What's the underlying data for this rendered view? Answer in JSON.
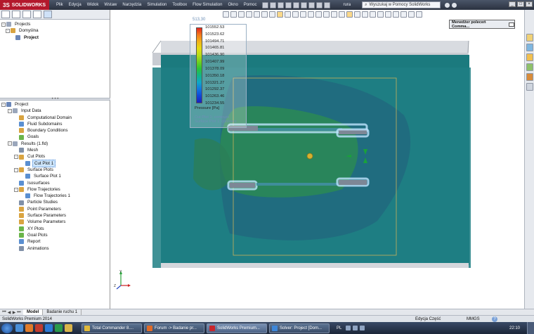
{
  "app": {
    "logo_ds": "3S",
    "logo_text": "SOLIDWORKS",
    "menu": [
      "Plik",
      "Edycja",
      "Widok",
      "Wstaw",
      "Narzędzia",
      "Simulation",
      "Toolbox",
      "Flow Simulation",
      "Okno",
      "Pomoc"
    ],
    "file_name": "rura",
    "search_placeholder": "Wyszukaj w Pomocy SolidWorks",
    "window_controls": [
      "_",
      "□",
      "×"
    ]
  },
  "left_top": {
    "root_label": "Projects",
    "config_label": "Domyślna",
    "project_label": "Project"
  },
  "tree": {
    "items": [
      {
        "label": "Project",
        "level": 0,
        "expand": "-",
        "icon_color": "#6a86b8"
      },
      {
        "label": "Input Data",
        "level": 1,
        "expand": "-",
        "icon_color": "#9aa6bb"
      },
      {
        "label": "Computational Domain",
        "level": 2,
        "expand": "",
        "icon_color": "#d9a441"
      },
      {
        "label": "Fluid Subdomains",
        "level": 2,
        "expand": "",
        "icon_color": "#5a8fd1"
      },
      {
        "label": "Boundary Conditions",
        "level": 2,
        "expand": "",
        "icon_color": "#d9a441"
      },
      {
        "label": "Goals",
        "level": 2,
        "expand": "",
        "icon_color": "#6bb54a"
      },
      {
        "label": "Results (1.fld)",
        "level": 1,
        "expand": "-",
        "icon_color": "#9aa6bb"
      },
      {
        "label": "Mesh",
        "level": 2,
        "expand": "",
        "icon_color": "#8090a8"
      },
      {
        "label": "Cut Plots",
        "level": 2,
        "expand": "-",
        "icon_color": "#d9a441"
      },
      {
        "label": "Cut Plot 1",
        "level": 3,
        "expand": "",
        "icon_color": "#5a8fd1",
        "selected": true
      },
      {
        "label": "Surface Plots",
        "level": 2,
        "expand": "-",
        "icon_color": "#d9a441"
      },
      {
        "label": "Surface Plot 1",
        "level": 3,
        "expand": "",
        "icon_color": "#5a8fd1"
      },
      {
        "label": "Isosurfaces",
        "level": 2,
        "expand": "",
        "icon_color": "#5a8fd1"
      },
      {
        "label": "Flow Trajectories",
        "level": 2,
        "expand": "-",
        "icon_color": "#d9a441"
      },
      {
        "label": "Flow Trajectories 1",
        "level": 3,
        "expand": "",
        "icon_color": "#5a8fd1"
      },
      {
        "label": "Particle Studies",
        "level": 2,
        "expand": "",
        "icon_color": "#8090a8"
      },
      {
        "label": "Point Parameters",
        "level": 2,
        "expand": "",
        "icon_color": "#d9a441"
      },
      {
        "label": "Surface Parameters",
        "level": 2,
        "expand": "",
        "icon_color": "#d9a441"
      },
      {
        "label": "Volume Parameters",
        "level": 2,
        "expand": "",
        "icon_color": "#d9a441"
      },
      {
        "label": "XY Plots",
        "level": 2,
        "expand": "",
        "icon_color": "#6bb54a"
      },
      {
        "label": "Goal Plots",
        "level": 2,
        "expand": "",
        "icon_color": "#6bb54a"
      },
      {
        "label": "Report",
        "level": 2,
        "expand": "",
        "icon_color": "#5a8fd1"
      },
      {
        "label": "Animations",
        "level": 2,
        "expand": "",
        "icon_color": "#8090a8"
      }
    ]
  },
  "graphics": {
    "command_manager_label": "Menedżer poleceń Comma...",
    "legend_top_value": "513,30",
    "legend_values": [
      "101552.53",
      "101523.62",
      "101494.71",
      "101465.81",
      "101436.90",
      "101407.99",
      "101378.09",
      "101350.18",
      "101321.27",
      "101292.37",
      "101263.46",
      "101234.55"
    ],
    "legend_unit": "Pressure [Pa]",
    "caption_line1": "Cut Plot 1: contours",
    "caption_line2": "Surface Plot 1: contours",
    "legend_colors": [
      "#e4261d",
      "#f47a1c",
      "#f2b21b",
      "#e6dc12",
      "#b6dc19",
      "#6fd11f",
      "#29c437",
      "#11b587",
      "#0fa7c7",
      "#1077e0",
      "#0f47d8",
      "#1a1fbe"
    ]
  },
  "bottom_tabs": [
    "Model",
    "Badanie ruchu 1"
  ],
  "status": {
    "left": "SolidWorks Premium 2014",
    "mode": "Edycja Część",
    "units": "MMGS",
    "help": "?"
  },
  "taskbar": {
    "tasks": [
      {
        "label": "Total Commander 8....",
        "color": "#e0b93a",
        "width": 86
      },
      {
        "label": "Forum -> Badanie pr...",
        "color": "#e06b28",
        "width": 86
      },
      {
        "label": "SolidWorks Premium...",
        "color": "#c8262d",
        "width": 86,
        "active": true
      },
      {
        "label": "Solver: Project [Dom...",
        "color": "#3d86d8",
        "width": 86
      }
    ],
    "lang": "PL",
    "clock": "22:10"
  }
}
